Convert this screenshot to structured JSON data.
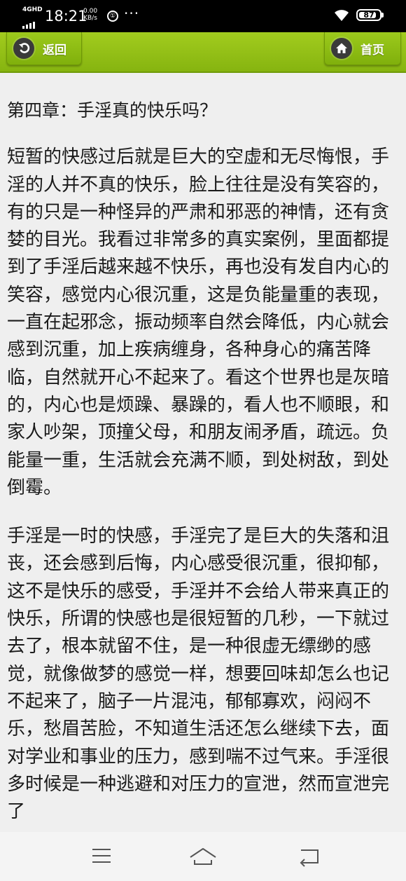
{
  "status_bar": {
    "network": "4GHD",
    "time": "18:21",
    "speed_value": "0.00",
    "speed_unit": "KB/s",
    "app_badge": "①",
    "more": "···",
    "battery": "87"
  },
  "header": {
    "back_label": "返回",
    "home_label": "首页"
  },
  "article": {
    "chapter_title": "第四章：手淫真的快乐吗？",
    "paragraphs": [
      "短暂的快感过后就是巨大的空虚和无尽悔恨，手淫的人并不真的快乐，脸上往往是没有笑容的，有的只是一种怪异的严肃和邪恶的神情，还有贪婪的目光。我看过非常多的真实案例，里面都提到了手淫后越来越不快乐，再也没有发自内心的笑容，感觉内心很沉重，这是负能量重的表现，一直在起邪念，振动频率自然会降低，内心就会感到沉重，加上疾病缠身，各种身心的痛苦降临，自然就开心不起来了。看这个世界也是灰暗的，内心也是烦躁、暴躁的，看人也不顺眼，和家人吵架，顶撞父母，和朋友闹矛盾，疏远。负能量一重，生活就会充满不顺，到处树敌，到处倒霉。",
      "手淫是一时的快感，手淫完了是巨大的失落和沮丧，还会感到后悔，内心感受很沉重，很抑郁，这不是快乐的感受，手淫并不会给人带来真正的快乐，所谓的快感也是很短暂的几秒，一下就过去了，根本就留不住，是一种很虚无缥缈的感觉，就像做梦的感觉一样，想要回味却怎么也记不起来了，脑子一片混沌，郁郁寡欢，闷闷不乐，愁眉苦脸，不知道生活还怎么继续下去，面对学业和事业的压力，感到喘不过气来。手淫很多时候是一种逃避和对压力的宣泄，然而宣泄完了"
    ]
  },
  "icons": {
    "back": "back-arrow-icon",
    "home": "house-icon",
    "nav_menu": "menu-lines-icon",
    "nav_home": "home-outline-icon",
    "nav_back": "return-arrow-icon"
  },
  "colors": {
    "header_green": "#8fbf14",
    "page_background": "#efefef",
    "text": "#1a1a1a"
  }
}
